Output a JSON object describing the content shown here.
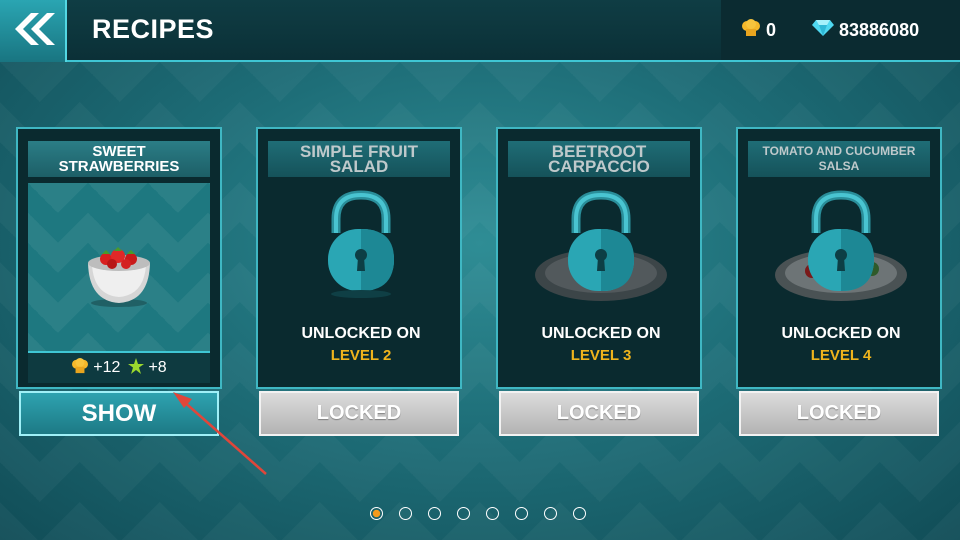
{
  "header": {
    "title": "RECIPES",
    "back_icon": "double-chevron-left-icon",
    "chef_hats": "0",
    "gems": "83886080"
  },
  "cards": [
    {
      "title": "SWEET STRAWBERRIES",
      "state": "unlocked",
      "reward_hats": "+12",
      "reward_stars": "+8",
      "button": "SHOW"
    },
    {
      "title": "SIMPLE FRUIT SALAD",
      "state": "locked",
      "unlock_text": "UNLOCKED ON",
      "unlock_level": "LEVEL 2",
      "button": "LOCKED"
    },
    {
      "title": "BEETROOT CARPACCIO",
      "state": "locked",
      "unlock_text": "UNLOCKED ON",
      "unlock_level": "LEVEL 3",
      "button": "LOCKED"
    },
    {
      "title": "TOMATO AND CUCUMBER SALSA",
      "state": "locked",
      "unlock_text": "UNLOCKED ON",
      "unlock_level": "LEVEL 4",
      "button": "LOCKED"
    }
  ],
  "pagination": {
    "total_pages": 8,
    "current_page": 1
  },
  "colors": {
    "accent": "#3fc6d4",
    "level_text": "#f0b41c",
    "gem": "#4fd8f0",
    "chef_hat": "#f5b82a",
    "star": "#9bd92e",
    "annotation_arrow": "#e0463a"
  }
}
